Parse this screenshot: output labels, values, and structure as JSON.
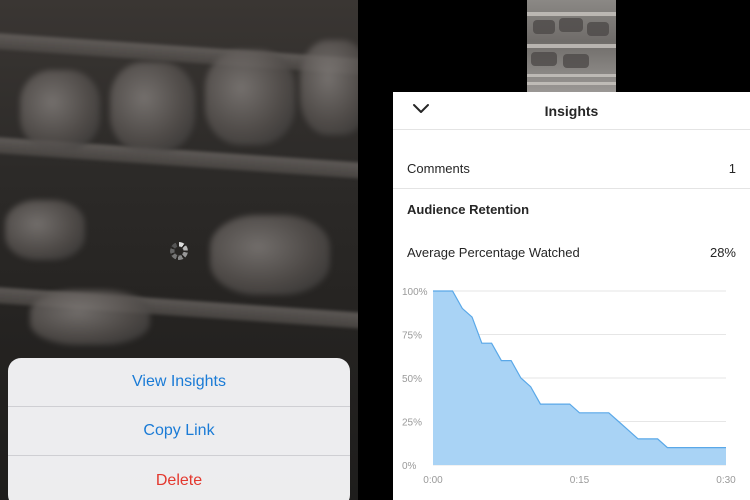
{
  "action_sheet": {
    "items": [
      {
        "label": "View Insights"
      },
      {
        "label": "Copy Link"
      },
      {
        "label": "Delete"
      }
    ]
  },
  "insights": {
    "title": "Insights",
    "comments": {
      "label": "Comments",
      "value": "1"
    },
    "audience_retention": {
      "title": "Audience Retention",
      "average_watched": {
        "label": "Average Percentage Watched",
        "value": "28%"
      }
    }
  },
  "icons": {
    "back": "chevron-down-icon",
    "loading": "loading-spinner-icon"
  },
  "colors": {
    "link": "#1a7bd6",
    "destructive": "#e3382e",
    "chart_fill": "#a9d3f5",
    "chart_line": "#5aa8e8"
  },
  "chart_data": {
    "type": "area",
    "title": "",
    "xlabel": "",
    "ylabel": "",
    "x": [
      0,
      1,
      2,
      3,
      4,
      5,
      6,
      7,
      8,
      9,
      10,
      11,
      12,
      13,
      14,
      15,
      16,
      17,
      18,
      19,
      20,
      21,
      22,
      23,
      24,
      25,
      26,
      27,
      28,
      29,
      30
    ],
    "values": [
      100,
      100,
      100,
      90,
      85,
      70,
      70,
      60,
      60,
      50,
      45,
      35,
      35,
      35,
      35,
      30,
      30,
      30,
      30,
      25,
      20,
      15,
      15,
      15,
      10,
      10,
      10,
      10,
      10,
      10,
      10
    ],
    "xlim": [
      0,
      30
    ],
    "ylim": [
      0,
      100
    ],
    "y_ticks": [
      0,
      25,
      50,
      75,
      100
    ],
    "y_tick_labels": [
      "0%",
      "25%",
      "50%",
      "75%",
      "100%"
    ],
    "x_ticks": [
      0,
      15,
      30
    ],
    "x_tick_labels": [
      "0:00",
      "0:15",
      "0:30"
    ],
    "grid": true
  }
}
